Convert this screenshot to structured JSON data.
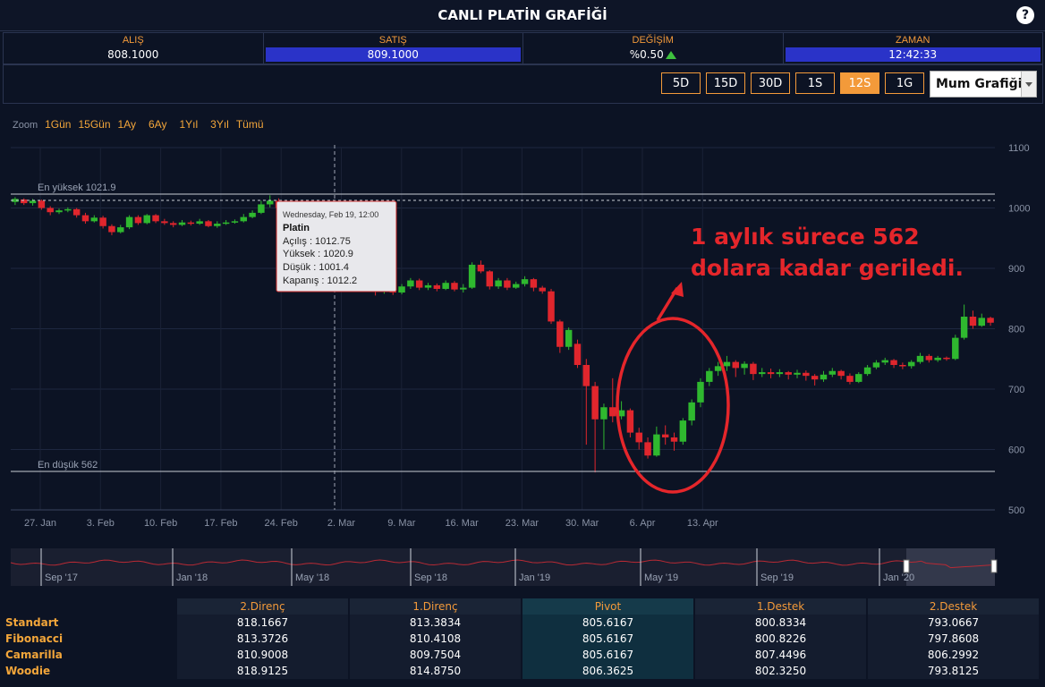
{
  "header": {
    "title": "CANLI PLATİN GRAFİĞİ",
    "help": "?"
  },
  "quotes": [
    {
      "label": "ALIŞ",
      "value": "808.1000"
    },
    {
      "label": "SATIŞ",
      "value": "809.1000"
    },
    {
      "label": "DEĞİŞİM",
      "value": "%0.50"
    },
    {
      "label": "ZAMAN",
      "value": "12:42:33"
    }
  ],
  "ranges": [
    "5D",
    "15D",
    "30D",
    "1S",
    "12S",
    "1G"
  ],
  "active_range": "12S",
  "chart_type_select": "Mum Grafiği",
  "zoom": {
    "label": "Zoom",
    "options": [
      "1Gün",
      "15Gün",
      "1Ay",
      "6Ay",
      "1Yıl",
      "3Yıl",
      "Tümü"
    ]
  },
  "tooltip": {
    "date": "Wednesday, Feb 19, 12:00",
    "name": "Platin",
    "open": "Açılış : 1012.75",
    "high": "Yüksek : 1020.9",
    "low": "Düşük : 1001.4",
    "close": "Kapanış : 1012.2"
  },
  "annotation": {
    "line1": "1 aylık sürece 562",
    "line2": "dolara kadar geriledi."
  },
  "chart_data": {
    "type": "candlestick",
    "ylim": [
      500,
      1100
    ],
    "yticks": [
      500,
      600,
      700,
      800,
      900,
      1000,
      1100
    ],
    "xticks": [
      "27. Jan",
      "3. Feb",
      "10. Feb",
      "17. Feb",
      "24. Feb",
      "2. Mar",
      "9. Mar",
      "16. Mar",
      "23. Mar",
      "30. Mar",
      "6. Apr",
      "13. Apr"
    ],
    "max_label": "En yüksek 1021.9",
    "max": 1021.9,
    "min_label": "En düşük 562",
    "min": 562,
    "candles": [
      {
        "o": 1010,
        "c": 1015,
        "h": 1018,
        "l": 1005
      },
      {
        "o": 1014,
        "c": 1008,
        "h": 1016,
        "l": 1005
      },
      {
        "o": 1008,
        "c": 1012,
        "h": 1015,
        "l": 1004
      },
      {
        "o": 1012,
        "c": 1000,
        "h": 1014,
        "l": 997
      },
      {
        "o": 1000,
        "c": 993,
        "h": 1003,
        "l": 988
      },
      {
        "o": 993,
        "c": 996,
        "h": 999,
        "l": 990
      },
      {
        "o": 996,
        "c": 998,
        "h": 1001,
        "l": 993
      },
      {
        "o": 998,
        "c": 988,
        "h": 1000,
        "l": 984
      },
      {
        "o": 988,
        "c": 978,
        "h": 992,
        "l": 974
      },
      {
        "o": 978,
        "c": 984,
        "h": 988,
        "l": 976
      },
      {
        "o": 984,
        "c": 970,
        "h": 987,
        "l": 966
      },
      {
        "o": 970,
        "c": 960,
        "h": 973,
        "l": 955
      },
      {
        "o": 960,
        "c": 968,
        "h": 972,
        "l": 958
      },
      {
        "o": 968,
        "c": 985,
        "h": 988,
        "l": 965
      },
      {
        "o": 985,
        "c": 975,
        "h": 988,
        "l": 972
      },
      {
        "o": 975,
        "c": 988,
        "h": 990,
        "l": 973
      },
      {
        "o": 988,
        "c": 978,
        "h": 990,
        "l": 975
      },
      {
        "o": 978,
        "c": 975,
        "h": 982,
        "l": 972
      },
      {
        "o": 975,
        "c": 972,
        "h": 978,
        "l": 968
      },
      {
        "o": 972,
        "c": 976,
        "h": 980,
        "l": 970
      },
      {
        "o": 976,
        "c": 974,
        "h": 979,
        "l": 971
      },
      {
        "o": 974,
        "c": 978,
        "h": 982,
        "l": 972
      },
      {
        "o": 978,
        "c": 970,
        "h": 980,
        "l": 968
      },
      {
        "o": 970,
        "c": 974,
        "h": 978,
        "l": 967
      },
      {
        "o": 974,
        "c": 976,
        "h": 980,
        "l": 972
      },
      {
        "o": 976,
        "c": 978,
        "h": 981,
        "l": 974
      },
      {
        "o": 978,
        "c": 985,
        "h": 990,
        "l": 976
      },
      {
        "o": 985,
        "c": 992,
        "h": 996,
        "l": 983
      },
      {
        "o": 992,
        "c": 1006,
        "h": 1012,
        "l": 990
      },
      {
        "o": 1006,
        "c": 1012,
        "h": 1021,
        "l": 1001
      },
      {
        "o": 1012,
        "c": 1000,
        "h": 1016,
        "l": 997
      },
      {
        "o": 1000,
        "c": 996,
        "h": 1004,
        "l": 992
      },
      {
        "o": 996,
        "c": 1006,
        "h": 1009,
        "l": 993
      },
      {
        "o": 1006,
        "c": 998,
        "h": 1010,
        "l": 995
      },
      {
        "o": 998,
        "c": 990,
        "h": 1002,
        "l": 986
      },
      {
        "o": 990,
        "c": 973,
        "h": 993,
        "l": 970
      },
      {
        "o": 973,
        "c": 928,
        "h": 976,
        "l": 924
      },
      {
        "o": 928,
        "c": 932,
        "h": 938,
        "l": 925
      },
      {
        "o": 932,
        "c": 920,
        "h": 935,
        "l": 915
      },
      {
        "o": 920,
        "c": 905,
        "h": 922,
        "l": 900
      },
      {
        "o": 905,
        "c": 880,
        "h": 908,
        "l": 876
      },
      {
        "o": 880,
        "c": 862,
        "h": 884,
        "l": 855
      },
      {
        "o": 862,
        "c": 872,
        "h": 876,
        "l": 858
      },
      {
        "o": 872,
        "c": 860,
        "h": 875,
        "l": 856
      },
      {
        "o": 860,
        "c": 870,
        "h": 874,
        "l": 857
      },
      {
        "o": 870,
        "c": 880,
        "h": 884,
        "l": 866
      },
      {
        "o": 880,
        "c": 868,
        "h": 883,
        "l": 864
      },
      {
        "o": 868,
        "c": 872,
        "h": 876,
        "l": 864
      },
      {
        "o": 872,
        "c": 866,
        "h": 875,
        "l": 862
      },
      {
        "o": 866,
        "c": 876,
        "h": 880,
        "l": 864
      },
      {
        "o": 876,
        "c": 865,
        "h": 879,
        "l": 862
      },
      {
        "o": 865,
        "c": 868,
        "h": 874,
        "l": 860
      },
      {
        "o": 868,
        "c": 906,
        "h": 910,
        "l": 866
      },
      {
        "o": 906,
        "c": 895,
        "h": 913,
        "l": 892
      },
      {
        "o": 895,
        "c": 870,
        "h": 897,
        "l": 865
      },
      {
        "o": 870,
        "c": 880,
        "h": 884,
        "l": 866
      },
      {
        "o": 880,
        "c": 868,
        "h": 884,
        "l": 864
      },
      {
        "o": 868,
        "c": 874,
        "h": 878,
        "l": 866
      },
      {
        "o": 874,
        "c": 882,
        "h": 887,
        "l": 870
      },
      {
        "o": 882,
        "c": 868,
        "h": 884,
        "l": 862
      },
      {
        "o": 868,
        "c": 862,
        "h": 871,
        "l": 858
      },
      {
        "o": 862,
        "c": 812,
        "h": 866,
        "l": 808
      },
      {
        "o": 812,
        "c": 770,
        "h": 815,
        "l": 760
      },
      {
        "o": 770,
        "c": 798,
        "h": 802,
        "l": 765
      },
      {
        "o": 775,
        "c": 740,
        "h": 782,
        "l": 735
      },
      {
        "o": 740,
        "c": 705,
        "h": 750,
        "l": 608
      },
      {
        "o": 705,
        "c": 650,
        "h": 712,
        "l": 562
      },
      {
        "o": 650,
        "c": 670,
        "h": 676,
        "l": 600
      },
      {
        "o": 670,
        "c": 655,
        "h": 718,
        "l": 645
      },
      {
        "o": 655,
        "c": 665,
        "h": 680,
        "l": 650
      },
      {
        "o": 665,
        "c": 628,
        "h": 668,
        "l": 620
      },
      {
        "o": 628,
        "c": 612,
        "h": 636,
        "l": 600
      },
      {
        "o": 612,
        "c": 590,
        "h": 620,
        "l": 585
      },
      {
        "o": 590,
        "c": 625,
        "h": 638,
        "l": 588
      },
      {
        "o": 625,
        "c": 620,
        "h": 640,
        "l": 608
      },
      {
        "o": 620,
        "c": 613,
        "h": 628,
        "l": 598
      },
      {
        "o": 613,
        "c": 648,
        "h": 652,
        "l": 608
      },
      {
        "o": 648,
        "c": 678,
        "h": 683,
        "l": 640
      },
      {
        "o": 678,
        "c": 712,
        "h": 718,
        "l": 670
      },
      {
        "o": 712,
        "c": 730,
        "h": 735,
        "l": 705
      },
      {
        "o": 730,
        "c": 738,
        "h": 745,
        "l": 722
      },
      {
        "o": 738,
        "c": 745,
        "h": 755,
        "l": 730
      },
      {
        "o": 745,
        "c": 735,
        "h": 748,
        "l": 720
      },
      {
        "o": 735,
        "c": 742,
        "h": 746,
        "l": 724
      },
      {
        "o": 742,
        "c": 725,
        "h": 745,
        "l": 715
      },
      {
        "o": 725,
        "c": 728,
        "h": 735,
        "l": 720
      },
      {
        "o": 728,
        "c": 725,
        "h": 734,
        "l": 718
      },
      {
        "o": 725,
        "c": 728,
        "h": 733,
        "l": 720
      },
      {
        "o": 728,
        "c": 724,
        "h": 730,
        "l": 716
      },
      {
        "o": 724,
        "c": 727,
        "h": 732,
        "l": 718
      },
      {
        "o": 727,
        "c": 722,
        "h": 731,
        "l": 714
      },
      {
        "o": 722,
        "c": 716,
        "h": 725,
        "l": 706
      },
      {
        "o": 716,
        "c": 724,
        "h": 730,
        "l": 712
      },
      {
        "o": 724,
        "c": 730,
        "h": 735,
        "l": 720
      },
      {
        "o": 730,
        "c": 722,
        "h": 732,
        "l": 716
      },
      {
        "o": 722,
        "c": 712,
        "h": 726,
        "l": 708
      },
      {
        "o": 712,
        "c": 725,
        "h": 728,
        "l": 710
      },
      {
        "o": 725,
        "c": 736,
        "h": 740,
        "l": 722
      },
      {
        "o": 736,
        "c": 744,
        "h": 748,
        "l": 733
      },
      {
        "o": 744,
        "c": 748,
        "h": 752,
        "l": 740
      },
      {
        "o": 748,
        "c": 740,
        "h": 750,
        "l": 735
      },
      {
        "o": 740,
        "c": 738,
        "h": 744,
        "l": 733
      },
      {
        "o": 738,
        "c": 745,
        "h": 748,
        "l": 734
      },
      {
        "o": 745,
        "c": 755,
        "h": 760,
        "l": 742
      },
      {
        "o": 755,
        "c": 748,
        "h": 758,
        "l": 744
      },
      {
        "o": 748,
        "c": 752,
        "h": 755,
        "l": 745
      },
      {
        "o": 752,
        "c": 750,
        "h": 754,
        "l": 747
      },
      {
        "o": 750,
        "c": 785,
        "h": 790,
        "l": 748
      },
      {
        "o": 785,
        "c": 820,
        "h": 840,
        "l": 782
      },
      {
        "o": 820,
        "c": 805,
        "h": 830,
        "l": 800
      },
      {
        "o": 805,
        "c": 818,
        "h": 825,
        "l": 803
      },
      {
        "o": 818,
        "c": 810,
        "h": 820,
        "l": 805
      }
    ],
    "navigator_labels": [
      "Sep '17",
      "Jan '18",
      "May '18",
      "Sep '18",
      "Jan '19",
      "May '19",
      "Sep '19",
      "Jan '20"
    ]
  },
  "pivot_table": {
    "headers": [
      "2.Direnç",
      "1.Direnç",
      "Pivot",
      "1.Destek",
      "2.Destek"
    ],
    "rows": [
      {
        "name": "Standart",
        "values": [
          "818.1667",
          "813.3834",
          "805.6167",
          "800.8334",
          "793.0667"
        ]
      },
      {
        "name": "Fibonacci",
        "values": [
          "813.3726",
          "810.4108",
          "805.6167",
          "800.8226",
          "797.8608"
        ]
      },
      {
        "name": "Camarilla",
        "values": [
          "810.9008",
          "809.7504",
          "805.6167",
          "807.4496",
          "806.2992"
        ]
      },
      {
        "name": "Woodie",
        "values": [
          "818.9125",
          "814.8750",
          "806.3625",
          "802.3250",
          "793.8125"
        ]
      }
    ]
  },
  "colors": {
    "up": "#2fb82f",
    "down": "#e0262d",
    "accent": "#f39a3a",
    "bid_blue": "#2a33c8",
    "annotation": "#e5262b"
  }
}
